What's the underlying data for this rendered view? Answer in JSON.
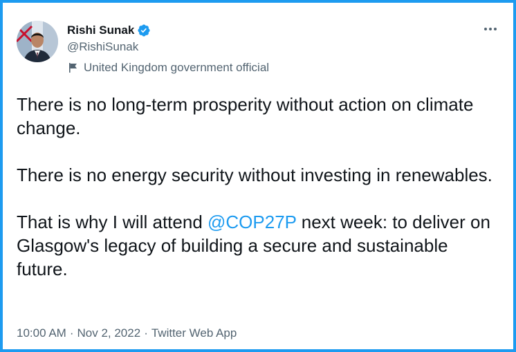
{
  "author": {
    "display_name": "Rishi Sunak",
    "handle": "@RishiSunak",
    "label": "United Kingdom government official",
    "verified": true,
    "avatar_icon": "portrait-avatar",
    "label_icon": "flag-icon"
  },
  "menu": {
    "more_glyph": "•••"
  },
  "tweet": {
    "paragraph_1": "There is no long-term prosperity without action on climate change.",
    "paragraph_2": "There is no energy security without investing in renewables.",
    "paragraph_3_before": "That is why I will attend ",
    "paragraph_3_mention": "@COP27P",
    "paragraph_3_after": " next week: to deliver on Glasgow's legacy of building a secure and sustainable future."
  },
  "meta": {
    "time": "10:00 AM",
    "separator": "·",
    "date": "Nov 2, 2022",
    "source": "Twitter Web App"
  },
  "colors": {
    "accent": "#1d9bf0",
    "text": "#0f1419",
    "secondary": "#536471"
  }
}
